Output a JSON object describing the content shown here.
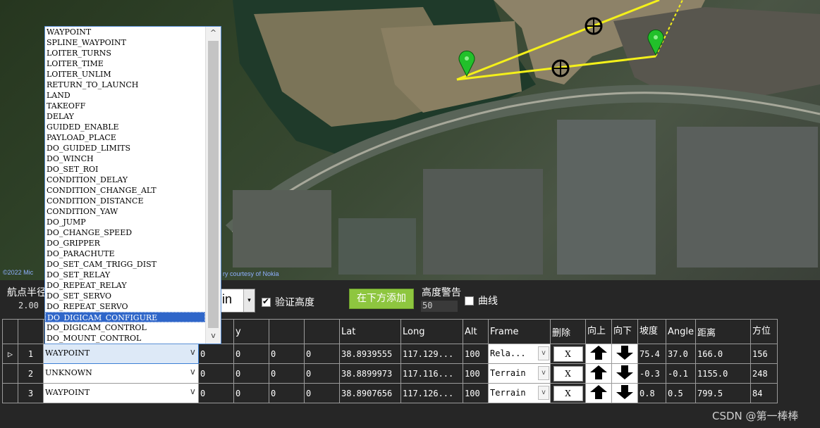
{
  "map": {
    "copyright": "©2022 Mic",
    "imagery": "ry courtesy of Nokia"
  },
  "controls": {
    "radius_label": "航点半径",
    "radius_value": "2.00",
    "alt_mode_value": "in",
    "alt_mode_arrow": "▾",
    "verify_height_label": "验证高度",
    "verify_height_checked": true,
    "add_below_label": "在下方添加",
    "alt_warning_label": "高度警告",
    "alt_warning_value": "50",
    "curve_label": "曲线",
    "curve_checked": false
  },
  "grid": {
    "headers": {
      "blank": "",
      "command": "",
      "p1": "",
      "p2": "y",
      "p3": "",
      "p4": "",
      "p5": "",
      "lat": "Lat",
      "long": "Long",
      "alt": "Alt",
      "frame": "Frame",
      "delete": "删除",
      "up": "向上",
      "down": "向下",
      "grad": "坡度",
      "angle": "Angle",
      "dist": "距离",
      "az": "方位"
    },
    "rows": [
      {
        "marker": "▷",
        "num": "1",
        "command": "WAYPOINT",
        "p1": "0",
        "p2": "0",
        "p3": "0",
        "p4": "0",
        "lat": "38.8939555",
        "long": "117.129...",
        "alt": "100",
        "frame": "Rela...",
        "del": "X",
        "grad": "75.4",
        "angle": "37.0",
        "dist": "166.0",
        "az": "156"
      },
      {
        "marker": "",
        "num": "2",
        "command": "UNKNOWN",
        "p1": "0",
        "p2": "0",
        "p3": "0",
        "p4": "0",
        "lat": "38.8899973",
        "long": "117.116...",
        "alt": "100",
        "frame": "Terrain",
        "del": "X",
        "grad": "-0.3",
        "angle": "-0.1",
        "dist": "1155.0",
        "az": "248"
      },
      {
        "marker": "",
        "num": "3",
        "command": "WAYPOINT",
        "p1": "0",
        "p2": "0",
        "p3": "0",
        "p4": "0",
        "lat": "38.8907656",
        "long": "117.126...",
        "alt": "100",
        "frame": "Terrain",
        "del": "X",
        "grad": "0.8",
        "angle": "0.5",
        "dist": "799.5",
        "az": "84"
      }
    ]
  },
  "dropdown": {
    "highlighted_index": 27,
    "options": [
      "WAYPOINT",
      "SPLINE_WAYPOINT",
      "LOITER_TURNS",
      "LOITER_TIME",
      "LOITER_UNLIM",
      "RETURN_TO_LAUNCH",
      "LAND",
      "TAKEOFF",
      "DELAY",
      "GUIDED_ENABLE",
      "PAYLOAD_PLACE",
      "DO_GUIDED_LIMITS",
      "DO_WINCH",
      "DO_SET_ROI",
      "CONDITION_DELAY",
      "CONDITION_CHANGE_ALT",
      "CONDITION_DISTANCE",
      "CONDITION_YAW",
      "DO_JUMP",
      "DO_CHANGE_SPEED",
      "DO_GRIPPER",
      "DO_PARACHUTE",
      "DO_SET_CAM_TRIGG_DIST",
      "DO_SET_RELAY",
      "DO_REPEAT_RELAY",
      "DO_SET_SERVO",
      "DO_REPEAT_SERVO",
      "DO_DIGICAM_CONFIGURE",
      "DO_DIGICAM_CONTROL",
      "DO_MOUNT_CONTROL"
    ]
  },
  "icons": {
    "scroll_up": "^",
    "scroll_down": "v",
    "combo_arrow": "v",
    "marker_color": "#22c02a",
    "route_color": "#f4f01a"
  },
  "watermark": "CSDN @第一棒棒"
}
